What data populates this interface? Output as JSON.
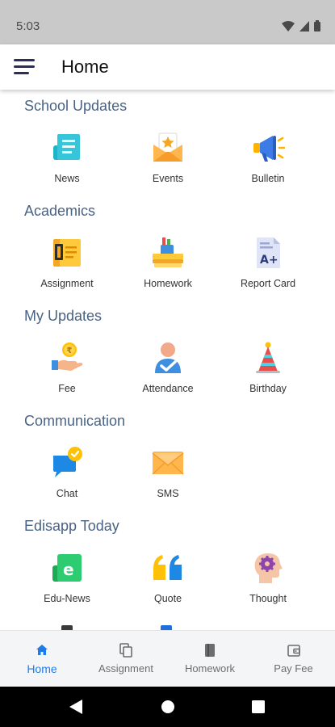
{
  "status_bar": {
    "time": "5:03"
  },
  "app_bar": {
    "title": "Home"
  },
  "sections": [
    {
      "title": "School Updates",
      "items": [
        {
          "label": "News",
          "icon": "news-icon"
        },
        {
          "label": "Events",
          "icon": "events-icon"
        },
        {
          "label": "Bulletin",
          "icon": "bulletin-icon"
        }
      ]
    },
    {
      "title": "Academics",
      "items": [
        {
          "label": "Assignment",
          "icon": "assignment-icon"
        },
        {
          "label": "Homework",
          "icon": "homework-icon"
        },
        {
          "label": "Report Card",
          "icon": "report-card-icon"
        }
      ]
    },
    {
      "title": "My Updates",
      "items": [
        {
          "label": "Fee",
          "icon": "fee-icon"
        },
        {
          "label": "Attendance",
          "icon": "attendance-icon"
        },
        {
          "label": "Birthday",
          "icon": "birthday-icon"
        }
      ]
    },
    {
      "title": "Communication",
      "items": [
        {
          "label": "Chat",
          "icon": "chat-icon"
        },
        {
          "label": "SMS",
          "icon": "sms-icon"
        }
      ]
    },
    {
      "title": "Edisapp Today",
      "items": [
        {
          "label": "Edu-News",
          "icon": "edu-news-icon"
        },
        {
          "label": "Quote",
          "icon": "quote-icon"
        },
        {
          "label": "Thought",
          "icon": "thought-icon"
        }
      ]
    }
  ],
  "bottom_nav": [
    {
      "label": "Home",
      "icon": "home-icon",
      "active": true
    },
    {
      "label": "Assignment",
      "icon": "assignment-icon"
    },
    {
      "label": "Homework",
      "icon": "homework-icon"
    },
    {
      "label": "Pay Fee",
      "icon": "wallet-icon"
    }
  ],
  "colors": {
    "accent": "#1e7ce8",
    "section_title": "#4a6385",
    "app_bar_icon": "#2b2d5e"
  }
}
